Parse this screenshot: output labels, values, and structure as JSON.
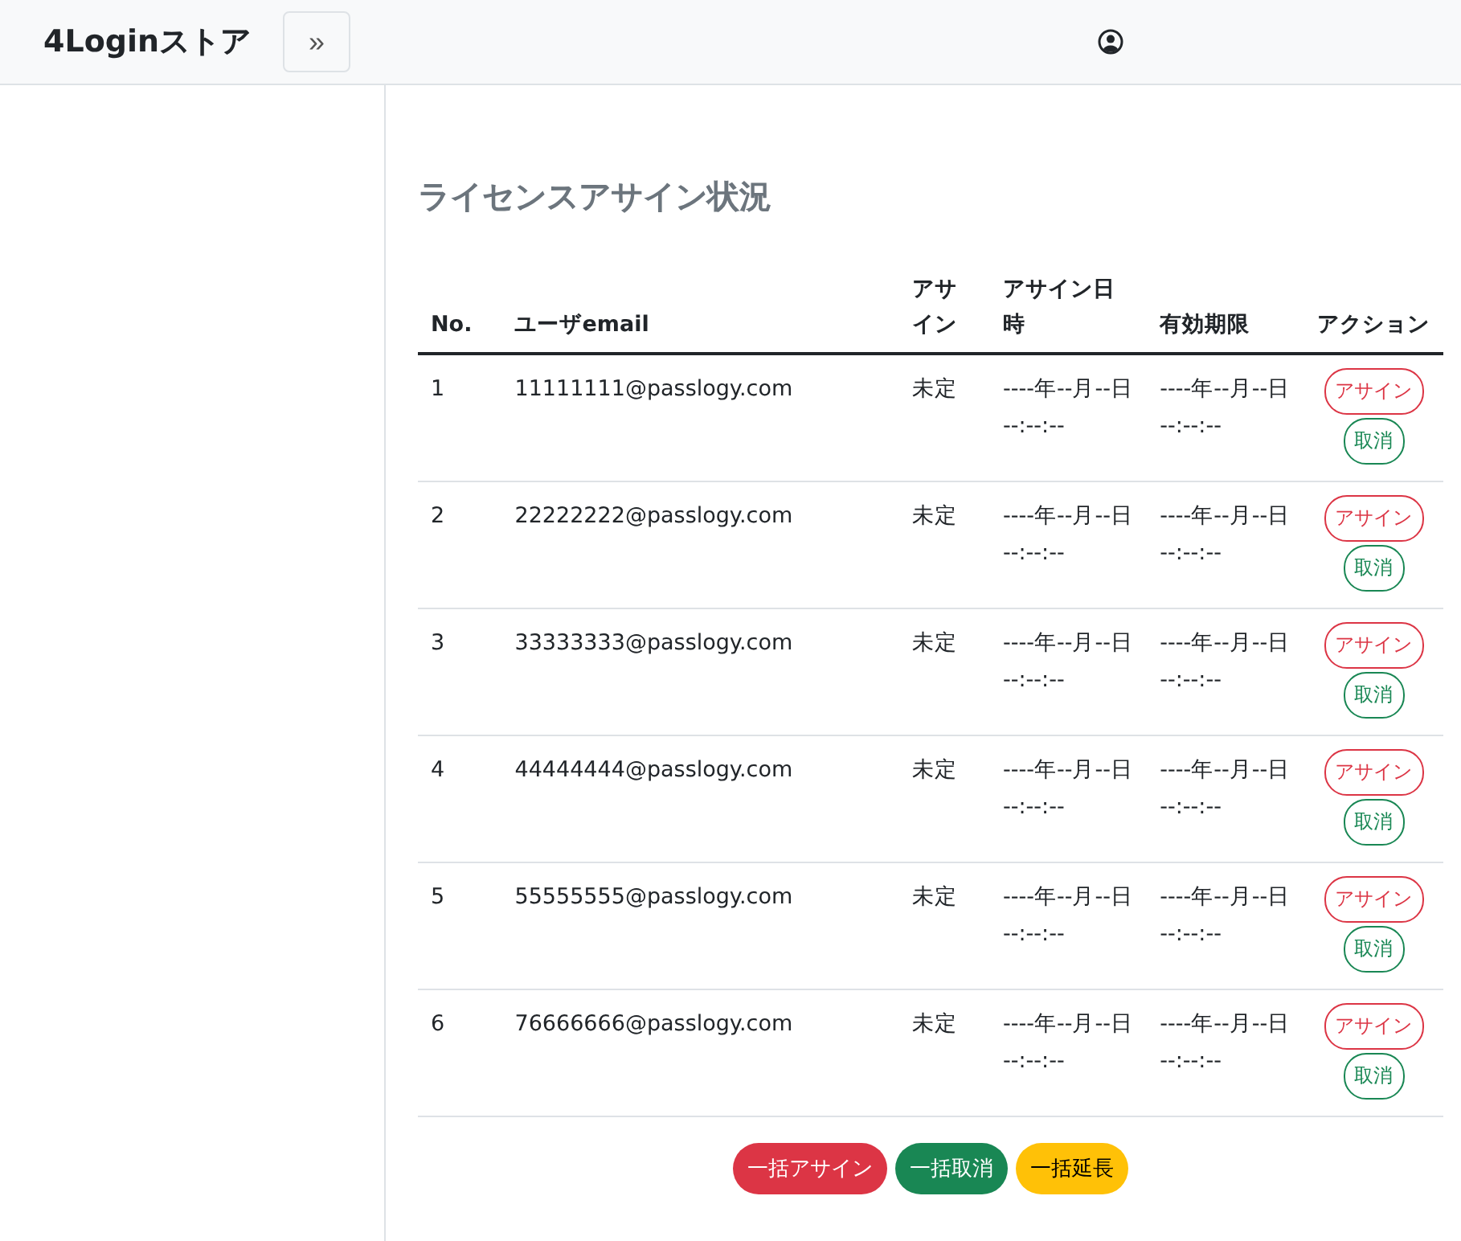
{
  "brand": "4Loginストア",
  "toggle": "»",
  "title": "ライセンスアサイン状況",
  "columns": [
    "No.",
    "ユーザemail",
    "アサイン",
    "アサイン日時",
    "有効期限",
    "アクション"
  ],
  "rows": [
    {
      "no": "1",
      "email": "11111111@passlogy.com",
      "status": "未定",
      "assigned_at": "----年--月--日 --:--:--",
      "expires": "----年--月--日 --:--:--",
      "actions": [
        {
          "label": "アサイン",
          "kind": "danger"
        },
        {
          "label": "取消",
          "kind": "success"
        }
      ]
    },
    {
      "no": "2",
      "email": "22222222@passlogy.com",
      "status": "未定",
      "assigned_at": "----年--月--日 --:--:--",
      "expires": "----年--月--日 --:--:--",
      "actions": [
        {
          "label": "アサイン",
          "kind": "danger"
        },
        {
          "label": "取消",
          "kind": "success"
        }
      ]
    },
    {
      "no": "3",
      "email": "33333333@passlogy.com",
      "status": "未定",
      "assigned_at": "----年--月--日 --:--:--",
      "expires": "----年--月--日 --:--:--",
      "actions": [
        {
          "label": "アサイン",
          "kind": "danger"
        },
        {
          "label": "取消",
          "kind": "success"
        }
      ]
    },
    {
      "no": "4",
      "email": "44444444@passlogy.com",
      "status": "未定",
      "assigned_at": "----年--月--日 --:--:--",
      "expires": "----年--月--日 --:--:--",
      "actions": [
        {
          "label": "アサイン",
          "kind": "danger"
        },
        {
          "label": "取消",
          "kind": "success"
        }
      ]
    },
    {
      "no": "5",
      "email": "55555555@passlogy.com",
      "status": "未定",
      "assigned_at": "----年--月--日 --:--:--",
      "expires": "----年--月--日 --:--:--",
      "actions": [
        {
          "label": "アサイン",
          "kind": "danger"
        },
        {
          "label": "取消",
          "kind": "success"
        }
      ]
    },
    {
      "no": "6",
      "email": "76666666@passlogy.com",
      "status": "未定",
      "assigned_at": "----年--月--日 --:--:--",
      "expires": "----年--月--日 --:--:--",
      "actions": [
        {
          "label": "アサイン",
          "kind": "danger"
        },
        {
          "label": "取消",
          "kind": "success"
        }
      ]
    }
  ],
  "bulk_buttons": [
    {
      "label": "一括アサイン",
      "kind": "danger"
    },
    {
      "label": "一括取消",
      "kind": "success"
    },
    {
      "label": "一括延長",
      "kind": "warning"
    }
  ]
}
